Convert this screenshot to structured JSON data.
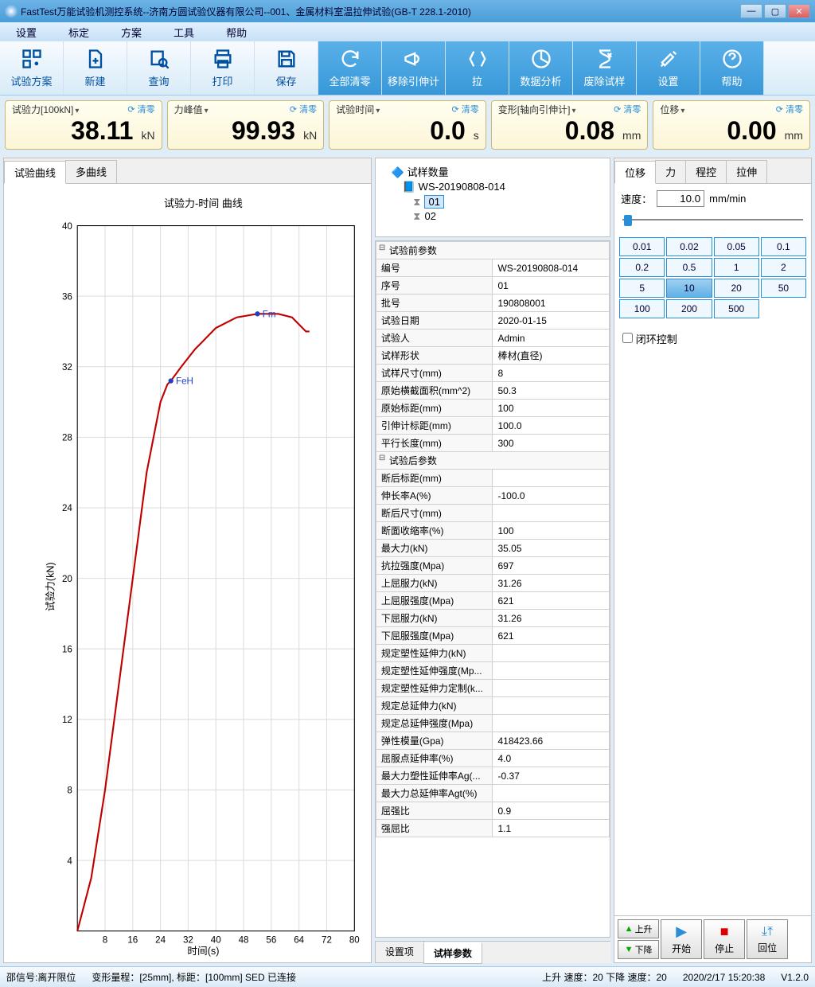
{
  "window_title": "FastTest万能试验机测控系统--济南方圆试验仪器有限公司--001、金属材料室温拉伸试验(GB-T 228.1-2010)",
  "menubar": [
    "设置",
    "标定",
    "方案",
    "工具",
    "帮助"
  ],
  "toolbar_g1": [
    {
      "label": "试验方案",
      "icon": "grid"
    },
    {
      "label": "新建",
      "icon": "file-plus"
    },
    {
      "label": "查询",
      "icon": "search"
    },
    {
      "label": "打印",
      "icon": "printer"
    },
    {
      "label": "保存",
      "icon": "save"
    }
  ],
  "toolbar_g2": [
    {
      "label": "全部清零",
      "icon": "refresh"
    },
    {
      "label": "移除引伸计",
      "icon": "megaphone"
    },
    {
      "label": "拉",
      "icon": "split"
    },
    {
      "label": "数据分析",
      "icon": "pie"
    },
    {
      "label": "废除试样",
      "icon": "hourglass-x"
    },
    {
      "label": "设置",
      "icon": "tools"
    },
    {
      "label": "帮助",
      "icon": "help"
    }
  ],
  "readouts": [
    {
      "label": "试验力[100kN]",
      "value": "38.11",
      "unit": "kN",
      "clear": "清零"
    },
    {
      "label": "力峰值",
      "value": "99.93",
      "unit": "kN",
      "clear": "清零"
    },
    {
      "label": "试验时间",
      "value": "0.0",
      "unit": "s",
      "clear": "清零"
    },
    {
      "label": "变形[轴向引伸计]",
      "value": "0.08",
      "unit": "mm",
      "clear": "清零"
    },
    {
      "label": "位移",
      "value": "0.00",
      "unit": "mm",
      "clear": "清零"
    }
  ],
  "left_tabs": [
    "试验曲线",
    "多曲线"
  ],
  "tree": {
    "root_label": "试样数量",
    "batch": "WS-20190808-014",
    "items": [
      "01",
      "02"
    ]
  },
  "pre_section": "试验前参数",
  "pre_params": [
    [
      "编号",
      "WS-20190808-014"
    ],
    [
      "序号",
      "01"
    ],
    [
      "批号",
      "190808001"
    ],
    [
      "试验日期",
      "2020-01-15"
    ],
    [
      "试验人",
      "Admin"
    ],
    [
      "试样形状",
      "棒材(直径)"
    ],
    [
      "试样尺寸(mm)",
      "8"
    ],
    [
      "原始横截面积(mm^2)",
      "50.3"
    ],
    [
      "原始标距(mm)",
      "100"
    ],
    [
      "引伸计标距(mm)",
      "100.0"
    ],
    [
      "平行长度(mm)",
      "300"
    ]
  ],
  "post_section": "试验后参数",
  "post_params": [
    [
      "断后标距(mm)",
      ""
    ],
    [
      "伸长率A(%)",
      "-100.0"
    ],
    [
      "断后尺寸(mm)",
      ""
    ],
    [
      "断面收缩率(%)",
      "100"
    ],
    [
      "最大力(kN)",
      "35.05"
    ],
    [
      "抗拉强度(Mpa)",
      "697"
    ],
    [
      "上屈服力(kN)",
      "31.26"
    ],
    [
      "上屈服强度(Mpa)",
      "621"
    ],
    [
      "下屈服力(kN)",
      "31.26"
    ],
    [
      "下屈服强度(Mpa)",
      "621"
    ],
    [
      "规定塑性延伸力(kN)",
      ""
    ],
    [
      "规定塑性延伸强度(Mp...",
      ""
    ],
    [
      "规定塑性延伸力定制(k...",
      ""
    ],
    [
      "规定总延伸力(kN)",
      ""
    ],
    [
      "规定总延伸强度(Mpa)",
      ""
    ],
    [
      "弹性模量(Gpa)",
      "418423.66"
    ],
    [
      "屈服点延伸率(%)",
      "4.0"
    ],
    [
      "最大力塑性延伸率Ag(...",
      "-0.37"
    ],
    [
      "最大力总延伸率Agt(%)",
      ""
    ],
    [
      "屈强比",
      "0.9"
    ],
    [
      "强屈比",
      "1.1"
    ]
  ],
  "bottom_tabs": [
    "设置项",
    "试样参数"
  ],
  "right_tabs": [
    "位移",
    "力",
    "程控",
    "拉伸"
  ],
  "speed": {
    "label": "速度：",
    "value": "10.0",
    "unit": "mm/min"
  },
  "speed_presets": [
    "0.01",
    "0.02",
    "0.05",
    "0.1",
    "0.2",
    "0.5",
    "1",
    "2",
    "5",
    "10",
    "20",
    "50",
    "100",
    "200",
    "500"
  ],
  "closed_loop": "闭环控制",
  "ctrl_up": "上升",
  "ctrl_down": "下降",
  "ctrl_start": "开始",
  "ctrl_stop": "停止",
  "ctrl_return": "回位",
  "status": {
    "left1": "邵信号:离开限位",
    "left2": "变形量程：[25mm], 标距：[100mm]  SED 已连接",
    "right1": "上升 速度：20 下降 速度：20",
    "right2": "2020/2/17 15:20:38",
    "version": "V1.2.0"
  },
  "chart_data": {
    "type": "line",
    "title": "试验力-时间 曲线",
    "xlabel": "时间(s)",
    "ylabel": "试验力(kN)",
    "xlim": [
      0,
      80
    ],
    "ylim": [
      0,
      40
    ],
    "xticks": [
      8,
      16,
      24,
      32,
      40,
      48,
      56,
      64,
      72,
      80
    ],
    "yticks": [
      4,
      8,
      12,
      16,
      20,
      24,
      28,
      32,
      36,
      40
    ],
    "annotations": [
      {
        "label": "FeH",
        "x": 27,
        "y": 31.2
      },
      {
        "label": "Fm",
        "x": 52,
        "y": 35.0
      }
    ],
    "series": [
      {
        "name": "试验力",
        "color": "#c00000",
        "x": [
          0,
          4,
          8,
          12,
          16,
          20,
          24,
          26,
          27,
          30,
          34,
          40,
          46,
          52,
          58,
          62,
          64,
          66,
          67
        ],
        "y": [
          0,
          3,
          8,
          14,
          20,
          26,
          30,
          31,
          31.2,
          32,
          33,
          34.2,
          34.8,
          35.0,
          35.0,
          34.8,
          34.4,
          34.0,
          34.0
        ]
      }
    ]
  }
}
